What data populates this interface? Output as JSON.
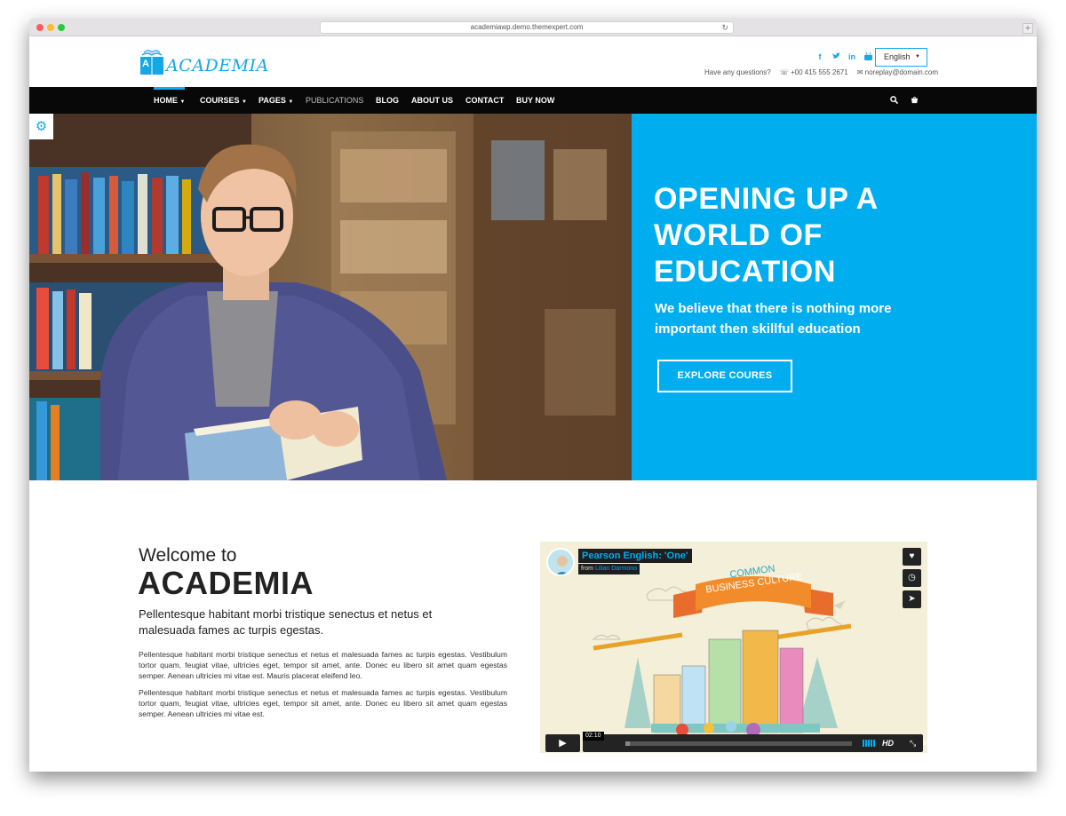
{
  "browser": {
    "url": "academiawp.demo.themexpert.com"
  },
  "header": {
    "logo_letter": "A",
    "logo_text": "ACADEMIA",
    "social_icons": [
      "facebook-icon",
      "twitter-icon",
      "linkedin-icon",
      "youtube-icon"
    ],
    "language": "English",
    "question": "Have any questions?",
    "phone": "+00 415 555 2671",
    "email": "noreplay@domain.com"
  },
  "nav": {
    "items": [
      "HOME",
      "COURSES",
      "PAGES",
      "PUBLICATIONS",
      "BLOG",
      "ABOUT US",
      "CONTACT",
      "BUY NOW"
    ]
  },
  "hero": {
    "title_lines": [
      "OPENING UP A",
      "WORLD OF",
      "EDUCATION"
    ],
    "subtitle_lines": [
      "We believe that there is nothing more",
      "important then skillful education"
    ],
    "button": "EXPLORE COURES"
  },
  "welcome": {
    "small": "Welcome to",
    "big": "ACADEMIA",
    "lead": "Pellentesque habitant morbi tristique senectus et netus et malesuada fames ac turpis egestas.",
    "paragraph1": "Pellentesque habitant morbi tristique senectus et netus et malesuada fames ac turpis egestas. Vestibulum tortor quam, feugiat vitae, ultricies eget, tempor sit amet, ante. Donec eu libero sit amet quam egestas semper. Aenean ultricies mi vitae est. Mauris placerat eleifend leo.",
    "paragraph2": "Pellentesque habitant morbi tristique senectus et netus et malesuada fames ac turpis egestas. Vestibulum tortor quam, feugiat vitae, ultricies eget, tempor sit amet, ante. Donec eu libero sit amet quam egestas semper. Aenean ultricies mi vitae est."
  },
  "video": {
    "title": "Pearson English: 'One'",
    "from_label": "from",
    "author": "Lilian Darmono",
    "banner_line1": "COMMON",
    "banner_line2": "BUSINESS CULTURE",
    "time": "02:10",
    "progress": 0.02,
    "hd": "HD",
    "brand": "vimeo"
  },
  "colors": {
    "accent": "#00aeef",
    "nav_bg": "#080808"
  }
}
